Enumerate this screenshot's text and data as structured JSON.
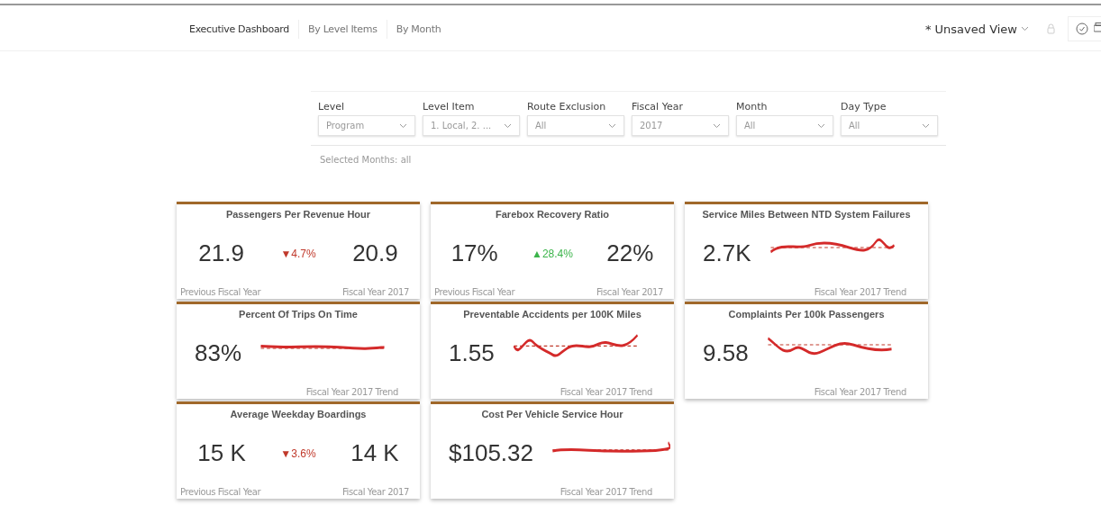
{
  "tabs": [
    {
      "label": "Executive Dashboard",
      "selected": true
    },
    {
      "label": "By Level Items",
      "selected": false
    },
    {
      "label": "By Month",
      "selected": false
    }
  ],
  "view": {
    "label": "* Unsaved View"
  },
  "filters": [
    {
      "label": "Level",
      "value": "Program"
    },
    {
      "label": "Level Item",
      "value": "1. Local, 2. ..."
    },
    {
      "label": "Route Exclusion",
      "value": "All"
    },
    {
      "label": "Fiscal Year",
      "value": "2017"
    },
    {
      "label": "Month",
      "value": "All"
    },
    {
      "label": "Day Type",
      "value": "All"
    }
  ],
  "selected_months": "Selected Months: all",
  "cards": [
    {
      "kind": "compare",
      "title": "Passengers Per Revenue Hour",
      "previous": "21.9",
      "change": "▼4.7%",
      "increase": false,
      "current": "20.9",
      "previous_label": "Previous Fiscal Year",
      "current_label": "Fiscal Year 2017"
    },
    {
      "kind": "compare",
      "title": "Farebox Recovery Ratio",
      "previous": "17%",
      "change": "▲28.4%",
      "increase": true,
      "current": "22%",
      "previous_label": "Previous Fiscal Year",
      "current_label": "Fiscal Year 2017"
    },
    {
      "kind": "trend",
      "title": "Service Miles Between NTD System Failures",
      "value": "2.7K",
      "trend_label": "Fiscal Year 2017 Trend"
    },
    {
      "kind": "trend",
      "title": "Percent Of Trips On Time",
      "value": "83%",
      "trend_label": "Fiscal Year 2017 Trend"
    },
    {
      "kind": "trend",
      "title": "Preventable Accidents per 100K Miles",
      "value": "1.55",
      "trend_label": "Fiscal Year 2017 Trend"
    },
    {
      "kind": "trend",
      "title": "Complaints Per 100k Passengers",
      "value": "9.58",
      "trend_label": "Fiscal Year 2017 Trend"
    },
    {
      "kind": "compare",
      "title": "Average Weekday Boardings",
      "previous": "15 K",
      "change": "▼3.6%",
      "increase": false,
      "current": "14 K",
      "previous_label": "Previous Fiscal Year",
      "current_label": "Fiscal Year 2017"
    },
    {
      "kind": "trend",
      "title": "Cost Per Vehicle Service Hour",
      "value": "$105.32",
      "trend_label": "Fiscal Year 2017 Trend"
    }
  ]
}
